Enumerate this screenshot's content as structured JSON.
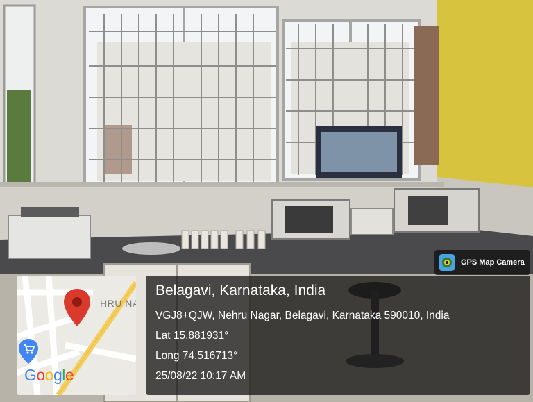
{
  "overlay": {
    "app_name": "GPS Map Camera",
    "map_label": "HRU NAGA",
    "map_logo_letters": [
      "G",
      "o",
      "o",
      "g",
      "l",
      "e"
    ],
    "place_title": "Belagavi, Karnataka, India",
    "address": "VGJ8+QJW, Nehru Nagar, Belagavi, Karnataka 590010, India",
    "latitude": "Lat 15.881931°",
    "longitude": "Long 74.516713°",
    "timestamp": "25/08/22 10:17 AM"
  },
  "icons": {
    "app_icon": "camera-lens-icon",
    "pin_icon": "map-pin-icon",
    "cart_icon": "shopping-cart-icon"
  },
  "colors": {
    "wall": "#d9d6cf",
    "yellow_wall": "#d6c23c",
    "pin_red": "#d93a2b",
    "road_yellow": "#f4cf5f",
    "google_blue": "#4285f4",
    "google_red": "#ea4335",
    "google_yellow": "#fbbc05",
    "google_green": "#34a853"
  }
}
